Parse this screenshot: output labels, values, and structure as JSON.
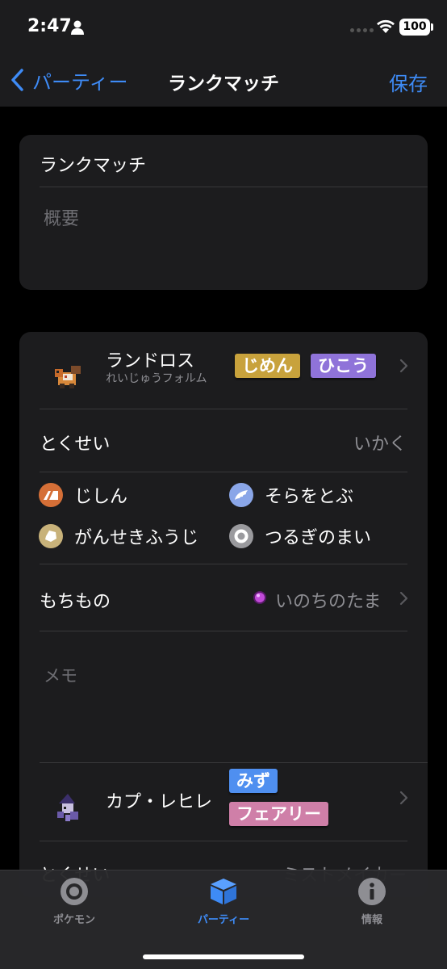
{
  "status_bar": {
    "time": "2:47",
    "battery": "100"
  },
  "nav": {
    "back_label": "パーティー",
    "title": "ランクマッチ",
    "save_label": "保存"
  },
  "party": {
    "name": "ランクマッチ",
    "description_placeholder": "概要"
  },
  "pokemon": [
    {
      "name": "ランドロス",
      "form": "れいじゅうフォルム",
      "types": [
        {
          "label": "じめん",
          "color": "#c8a23c"
        },
        {
          "label": "ひこう",
          "color": "#8f73d9"
        }
      ],
      "ability_label": "とくせい",
      "ability": "いかく",
      "moves": [
        {
          "name": "じしん",
          "icon": "ground-type-icon",
          "color": "#d56f37"
        },
        {
          "name": "そらをとぶ",
          "icon": "flying-type-icon",
          "color": "#8aa6e8"
        },
        {
          "name": "がんせきふうじ",
          "icon": "rock-type-icon",
          "color": "#c8b27a"
        },
        {
          "name": "つるぎのまい",
          "icon": "normal-type-icon",
          "color": "#9a9a9e"
        }
      ],
      "item_label": "もちもの",
      "item": "いのちのたま",
      "memo_placeholder": "メモ"
    },
    {
      "name": "カプ・レヒレ",
      "types": [
        {
          "label": "みず",
          "color": "#4f8ff0"
        },
        {
          "label": "フェアリー",
          "color": "#cf7fa8"
        }
      ],
      "ability_label": "とくせい",
      "ability": "ミストメイカー"
    }
  ],
  "tabs": [
    {
      "label": "ポケモン",
      "icon": "pokeball-icon",
      "active": false
    },
    {
      "label": "パーティー",
      "icon": "box-icon",
      "active": true
    },
    {
      "label": "情報",
      "icon": "info-icon",
      "active": false
    }
  ]
}
